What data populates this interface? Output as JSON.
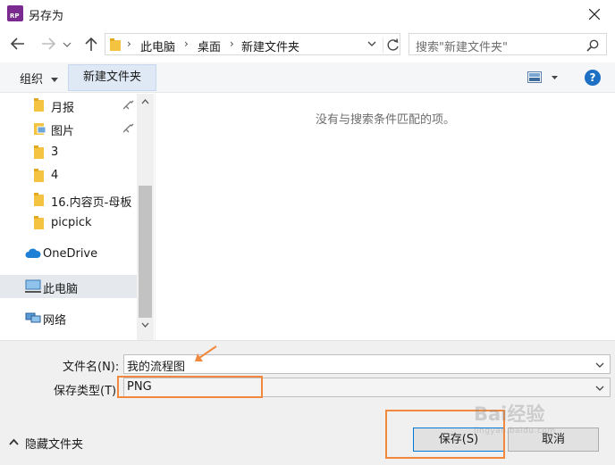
{
  "window": {
    "title": "另存为",
    "app_badge": "RP"
  },
  "nav": {
    "breadcrumb": [
      "此电脑",
      "桌面",
      "新建文件夹"
    ],
    "search_placeholder": "搜索\"新建文件夹\""
  },
  "toolbar": {
    "organize_label": "组织",
    "new_folder_label": "新建文件夹",
    "help_label": "?"
  },
  "sidebar": {
    "items": [
      {
        "label": "月报",
        "icon": "folder-icon",
        "pinned": true
      },
      {
        "label": "图片",
        "icon": "pictures-folder-icon",
        "pinned": true
      },
      {
        "label": "3",
        "icon": "folder-icon",
        "pinned": false
      },
      {
        "label": "4",
        "icon": "folder-icon",
        "pinned": false
      },
      {
        "label": "16.内容页-母板",
        "icon": "folder-icon",
        "pinned": false
      },
      {
        "label": "picpick",
        "icon": "folder-icon",
        "pinned": false
      },
      {
        "label": "OneDrive",
        "icon": "cloud-icon",
        "pinned": false
      },
      {
        "label": "此电脑",
        "icon": "computer-icon",
        "pinned": false,
        "selected": true
      },
      {
        "label": "网络",
        "icon": "network-icon",
        "pinned": false
      }
    ]
  },
  "content": {
    "empty_message": "没有与搜索条件匹配的项。"
  },
  "form": {
    "filename_label": "文件名(N):",
    "filename_value": "我的流程图",
    "filetype_label": "保存类型(T):",
    "filetype_value": "PNG"
  },
  "footer": {
    "hide_folders_label": "隐藏文件夹",
    "save_label": "保存(S)",
    "cancel_label": "取消"
  },
  "watermark": {
    "text": "Bai经验",
    "url": "jingyan.baidu.com"
  },
  "colors": {
    "annotation": "#f0883e",
    "folder": "#f5c342",
    "accent": "#0078d7",
    "selected_bg": "#e5e9ee"
  }
}
